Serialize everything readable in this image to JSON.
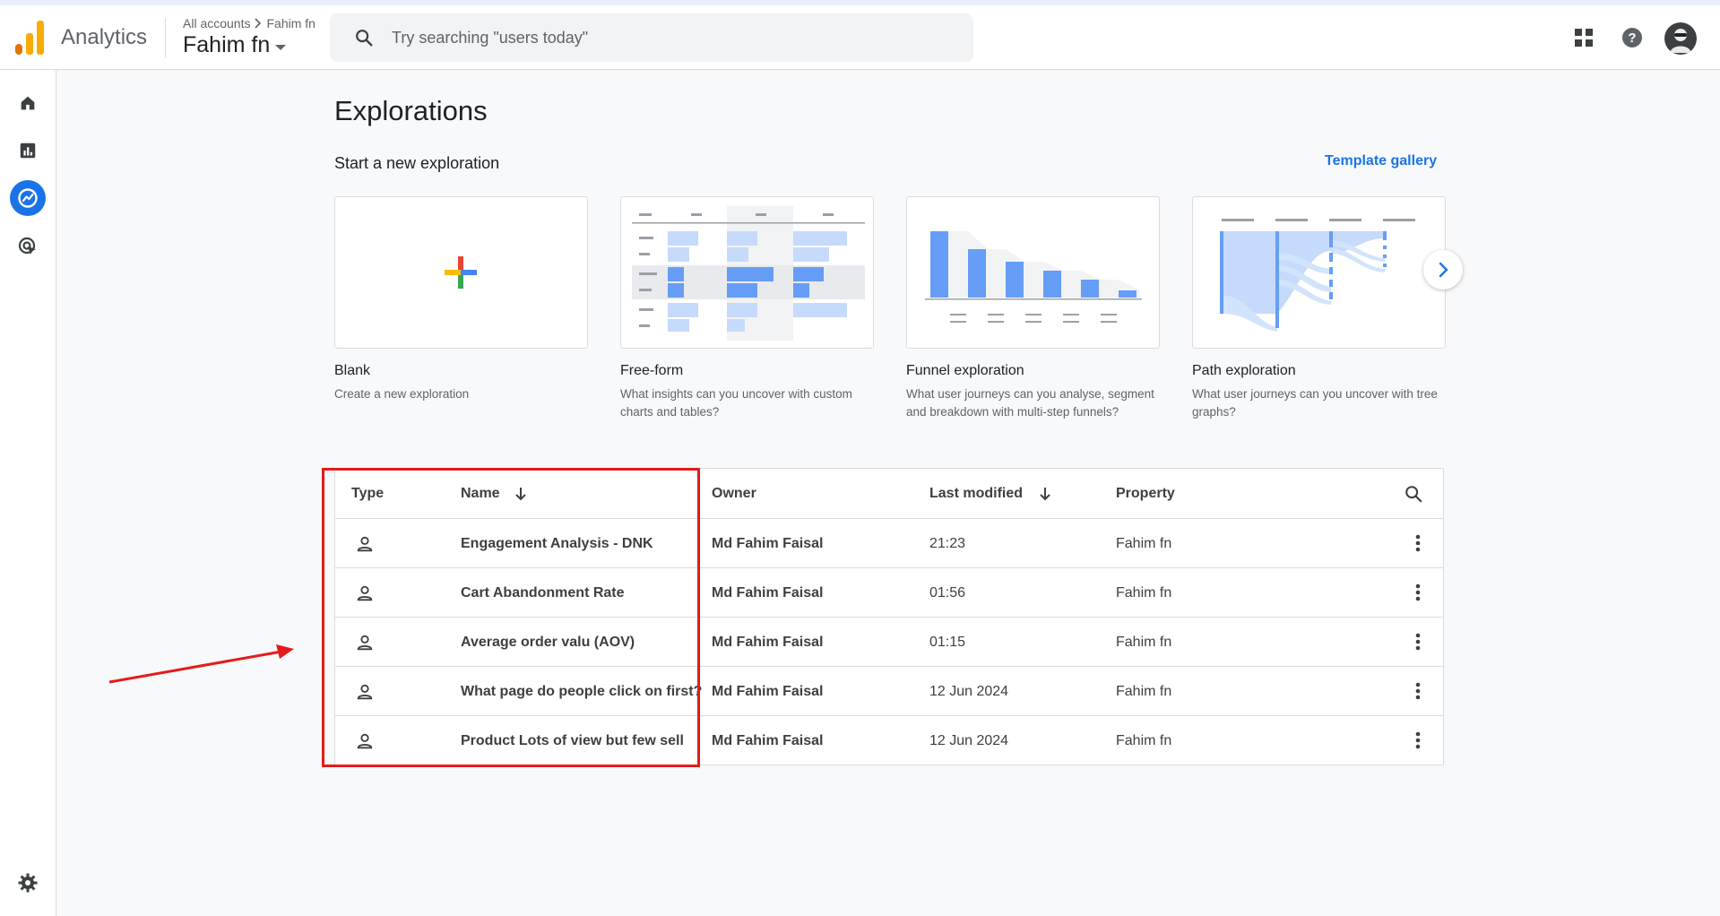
{
  "header": {
    "app_name": "Analytics",
    "breadcrumb": {
      "all_accounts": "All accounts",
      "account": "Fahim fn"
    },
    "account_name": "Fahim fn",
    "search_placeholder": "Try searching \"users today\""
  },
  "rail": {
    "items": [
      {
        "icon": "home-icon"
      },
      {
        "icon": "reports-icon"
      },
      {
        "icon": "explore-icon",
        "active": true
      },
      {
        "icon": "advertising-icon"
      }
    ],
    "settings_icon": "gear-icon"
  },
  "main": {
    "title": "Explorations",
    "subtitle": "Start a new exploration",
    "template_gallery": "Template gallery",
    "cards": [
      {
        "title": "Blank",
        "desc": "Create a new exploration"
      },
      {
        "title": "Free-form",
        "desc": "What insights can you uncover with custom charts and tables?"
      },
      {
        "title": "Funnel exploration",
        "desc": "What user journeys can you analyse, segment and breakdown with multi-step funnels?"
      },
      {
        "title": "Path exploration",
        "desc": "What user journeys can you uncover with tree graphs?"
      }
    ]
  },
  "table": {
    "headers": {
      "type": "Type",
      "name": "Name",
      "owner": "Owner",
      "last_modified": "Last modified",
      "property": "Property"
    },
    "rows": [
      {
        "name": "Engagement Analysis - DNK",
        "owner": "Md Fahim Faisal",
        "modified": "21:23",
        "property": "Fahim fn"
      },
      {
        "name": "Cart Abandonment Rate",
        "owner": "Md Fahim Faisal",
        "modified": "01:56",
        "property": "Fahim fn"
      },
      {
        "name": "Average order valu (AOV)",
        "owner": "Md Fahim Faisal",
        "modified": "01:15",
        "property": "Fahim fn"
      },
      {
        "name": "What page do people click on first?",
        "owner": "Md Fahim Faisal",
        "modified": "12 Jun 2024",
        "property": "Fahim fn"
      },
      {
        "name": "Product Lots of view but few sell",
        "owner": "Md Fahim Faisal",
        "modified": "12 Jun 2024",
        "property": "Fahim fn"
      }
    ]
  },
  "colors": {
    "accent": "#1a73e8",
    "annotation": "#e41b1b",
    "logo_orange": "#f9ab00",
    "logo_dark": "#e37400"
  }
}
